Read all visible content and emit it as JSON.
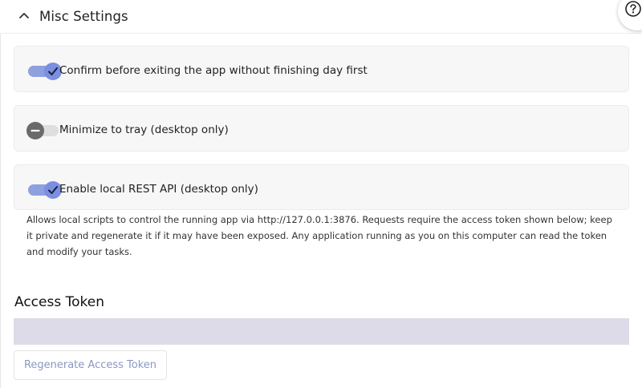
{
  "section": {
    "title": "Misc Settings",
    "expanded": true
  },
  "help": {
    "icon": "help-icon"
  },
  "settings": [
    {
      "label": "Confirm before exiting the app without finishing day first",
      "enabled": true
    },
    {
      "label": "Minimize to tray (desktop only)",
      "enabled": false
    },
    {
      "label": "Enable local REST API (desktop only)",
      "enabled": true
    }
  ],
  "rest_api_hint": "Allows local scripts to control the running app via http://127.0.0.1:3876. Requests require the access token shown below; keep it private and regenerate it if it may have been exposed. Any application running as you on this computer can read the token and modify your tasks.",
  "access_token": {
    "title": "Access Token",
    "value": "",
    "regenerate_label": "Regenerate Access Token"
  },
  "colors": {
    "toggle_on": "#7b8fe0",
    "toggle_off_knob": "#6a6a6a",
    "token_field_bg": "#dddbe7",
    "button_text": "#8a98c4"
  }
}
